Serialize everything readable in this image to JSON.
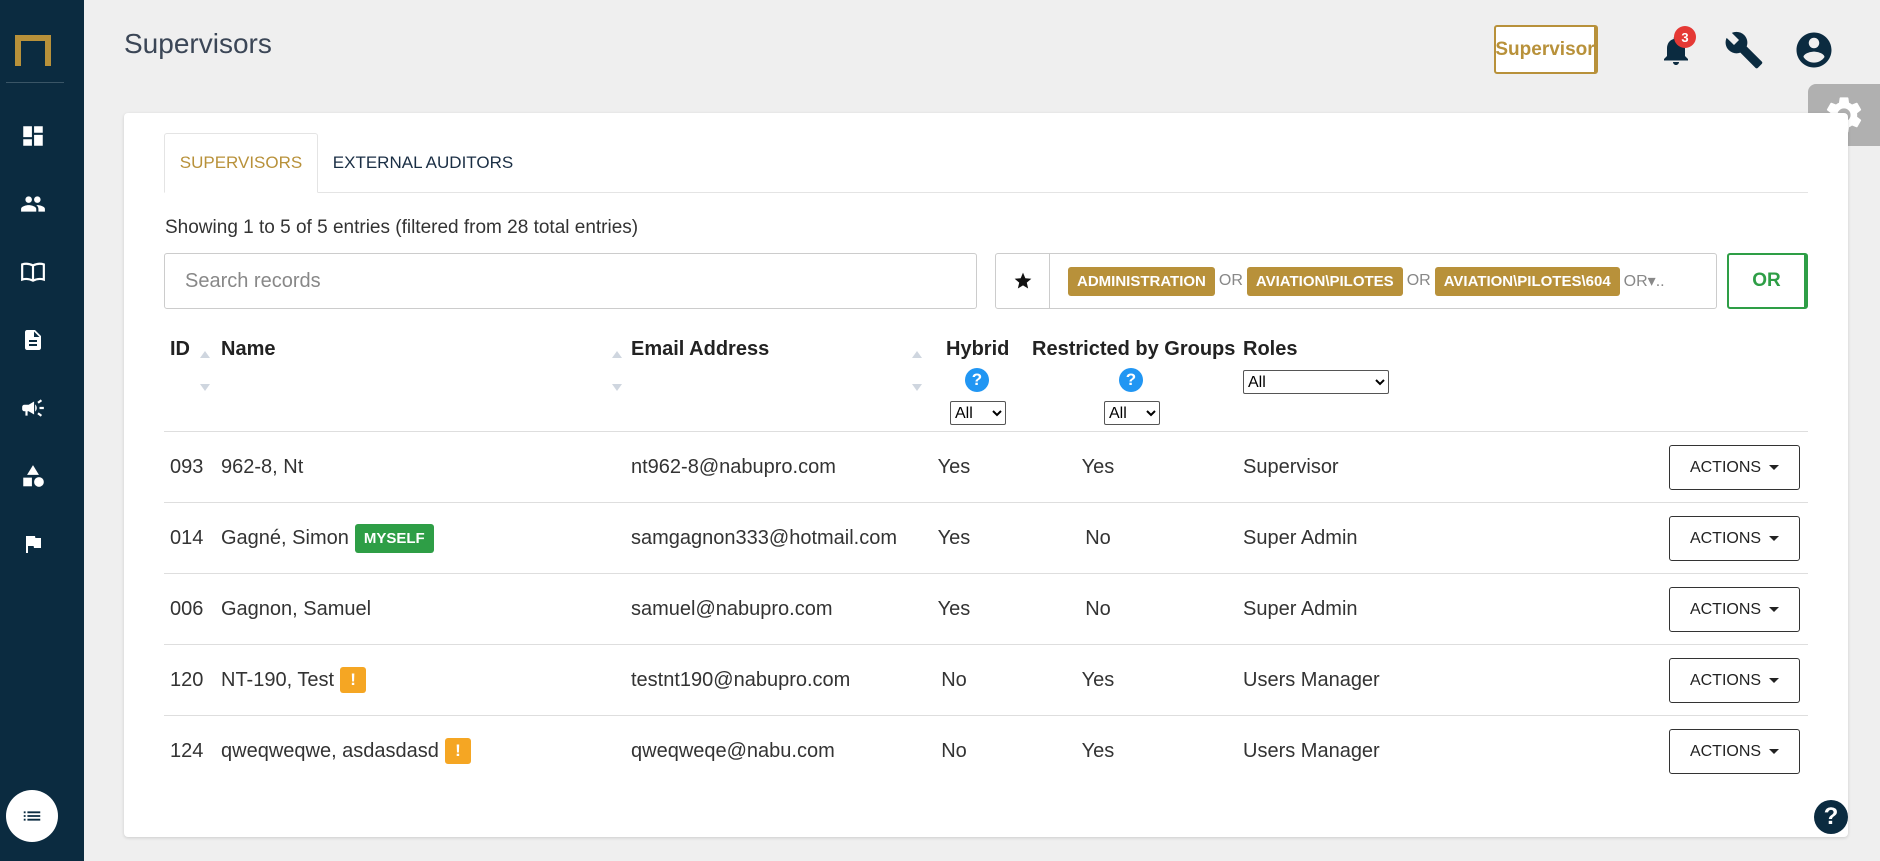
{
  "page": {
    "title": "Supervisors"
  },
  "header": {
    "role_button": "Supervisor",
    "notification_count": "3"
  },
  "tabs": [
    {
      "label": "SUPERVISORS",
      "active": true
    },
    {
      "label": "EXTERNAL AUDITORS",
      "active": false
    }
  ],
  "summary": "Showing 1 to 5 of 5 entries (filtered from 28 total entries)",
  "search": {
    "placeholder": "Search records",
    "value": ""
  },
  "filter": {
    "chips": [
      "ADMINISTRATION",
      "AVIATION\\PILOTES",
      "AVIATION\\PILOTES\\604"
    ],
    "separator": "OR",
    "trailing": "OR▾..",
    "mode_button": "OR"
  },
  "table": {
    "headers": {
      "id": "ID",
      "name": "Name",
      "email": "Email Address",
      "hybrid": "Hybrid",
      "restricted": "Restricted by Groups",
      "roles": "Roles"
    },
    "filters": {
      "hybrid": "All",
      "restricted": "All",
      "roles": "All"
    },
    "help_glyph": "?",
    "rows": [
      {
        "id": "093",
        "name": "962-8, Nt",
        "tag": "",
        "warn": false,
        "email": "nt962-8@nabupro.com",
        "hybrid": "Yes",
        "restricted": "Yes",
        "role": "Supervisor",
        "action": "ACTIONS"
      },
      {
        "id": "014",
        "name": "Gagné, Simon",
        "tag": "MYSELF",
        "warn": false,
        "email": "samgagnon333@hotmail.com",
        "hybrid": "Yes",
        "restricted": "No",
        "role": "Super Admin",
        "action": "ACTIONS"
      },
      {
        "id": "006",
        "name": "Gagnon, Samuel",
        "tag": "",
        "warn": false,
        "email": "samuel@nabupro.com",
        "hybrid": "Yes",
        "restricted": "No",
        "role": "Super Admin",
        "action": "ACTIONS"
      },
      {
        "id": "120",
        "name": "NT-190, Test",
        "tag": "",
        "warn": true,
        "email": "testnt190@nabupro.com",
        "hybrid": "No",
        "restricted": "Yes",
        "role": "Users Manager",
        "action": "ACTIONS"
      },
      {
        "id": "124",
        "name": "qweqweqwe, asdasdasd",
        "tag": "",
        "warn": true,
        "email": "qweqweqe@nabu.com",
        "hybrid": "No",
        "restricted": "Yes",
        "role": "Users Manager",
        "action": "ACTIONS"
      }
    ]
  },
  "warn_glyph": "!",
  "help_glyph_bottom": "?",
  "colors": {
    "sidebar": "#0b2b40",
    "accent_gold": "#b8913a",
    "success_green": "#2e9e46",
    "warning_orange": "#f5a623",
    "help_blue": "#2196f3",
    "badge_red": "#e53935"
  },
  "icons": {
    "sidebar": [
      "dashboard-icon",
      "users-icon",
      "book-icon",
      "document-icon",
      "megaphone-icon",
      "shapes-icon",
      "flag-icon"
    ],
    "sidebar_bottom": "list-icon",
    "header": [
      "bell-icon",
      "wrench-icon",
      "account-icon"
    ],
    "settings": "gear-icon",
    "filter": "star-icon"
  }
}
